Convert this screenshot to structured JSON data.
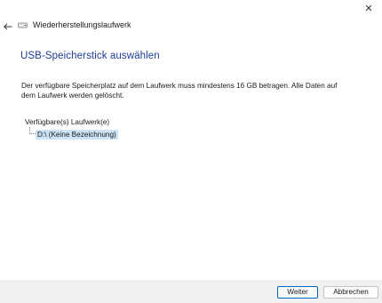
{
  "window": {
    "title": "Wiederherstellungslaufwerk",
    "close_glyph": "✕",
    "back_glyph": "←"
  },
  "page": {
    "heading": "USB-Speicherstick auswählen",
    "description": "Der verfügbare Speicherplatz auf dem Laufwerk muss mindestens 16 GB betragen. Alle Daten auf dem Laufwerk werden gelöscht.",
    "drives_label": "Verfügbare(s) Laufwerk(e)",
    "drives": [
      {
        "label": "D:\\ (Keine Bezeichnung)",
        "selected": true
      }
    ]
  },
  "buttons": {
    "next": "Weiter",
    "cancel": "Abbrechen"
  },
  "colors": {
    "accent": "#1f3d99",
    "selection": "#cce4f7",
    "footer": "#f0f0f0",
    "default_button_border": "#0067c0"
  },
  "icons": {
    "title_icon": "drive-icon",
    "back": "arrow-left-icon",
    "close": "close-icon"
  }
}
